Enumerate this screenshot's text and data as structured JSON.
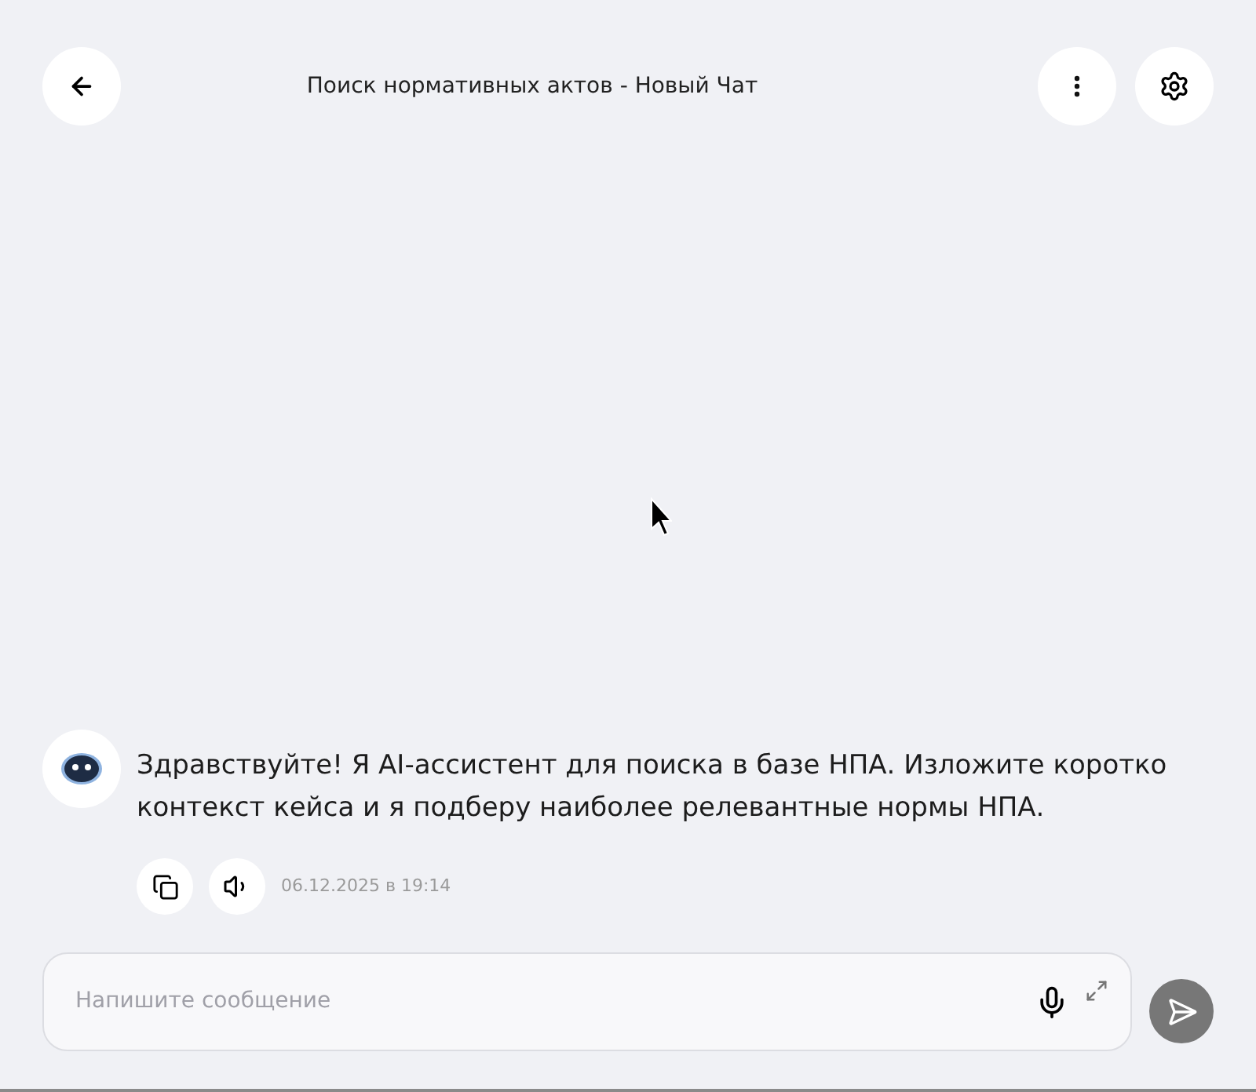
{
  "header": {
    "title": "Поиск нормативных актов - Новый Чат"
  },
  "messages": [
    {
      "text": "Здравствуйте! Я AI-ассистент для поиска в базе НПА. Изложите коротко контекст кейса и я подберу наиболее релевантные нормы НПА.",
      "time": "06.12.2025 в 19:14"
    }
  ],
  "composer": {
    "placeholder": "Напишите сообщение"
  }
}
